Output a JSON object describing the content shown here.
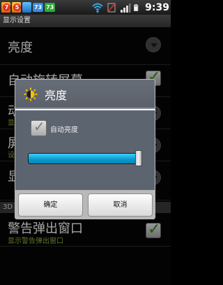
{
  "status_bar": {
    "notifications": [
      {
        "icon": "notification-badge-icon",
        "badge": "7"
      },
      {
        "icon": "notification-badge-icon",
        "badge": "5"
      },
      {
        "icon": "app-notification-icon",
        "badge": ""
      }
    ],
    "chips": [
      "73",
      "73"
    ],
    "icons": [
      "wifi-icon",
      "signal-off-icon",
      "signal-bars-icon",
      "battery-icon"
    ],
    "time": "9:39"
  },
  "screen": {
    "title": "显示设置"
  },
  "settings": {
    "rows": [
      {
        "label": "亮度",
        "sub": "",
        "control": "chevron"
      },
      {
        "label": "自动旋转屏幕",
        "sub": "",
        "control": "checkbox"
      },
      {
        "label": "动",
        "sub": "显",
        "control": "chevron"
      },
      {
        "label": "屏",
        "sub": "设",
        "control": "chevron"
      },
      {
        "label": "显",
        "sub": "",
        "control": "chevron"
      }
    ],
    "section_label": "3D",
    "last_row": {
      "label": "警告弹出窗口",
      "sub": "显示警告弹出窗口",
      "control": "checkbox"
    }
  },
  "dialog": {
    "title": "亮度",
    "icon": "brightness-icon",
    "auto_brightness_label": "自动亮度",
    "auto_brightness_checked": true,
    "brightness_level": 0.98,
    "ok_label": "确定",
    "cancel_label": "取消"
  },
  "colors": {
    "accent_green": "#8fb83a",
    "slider_fill": "#0a98cc",
    "dialog_header": "#5f6670"
  }
}
